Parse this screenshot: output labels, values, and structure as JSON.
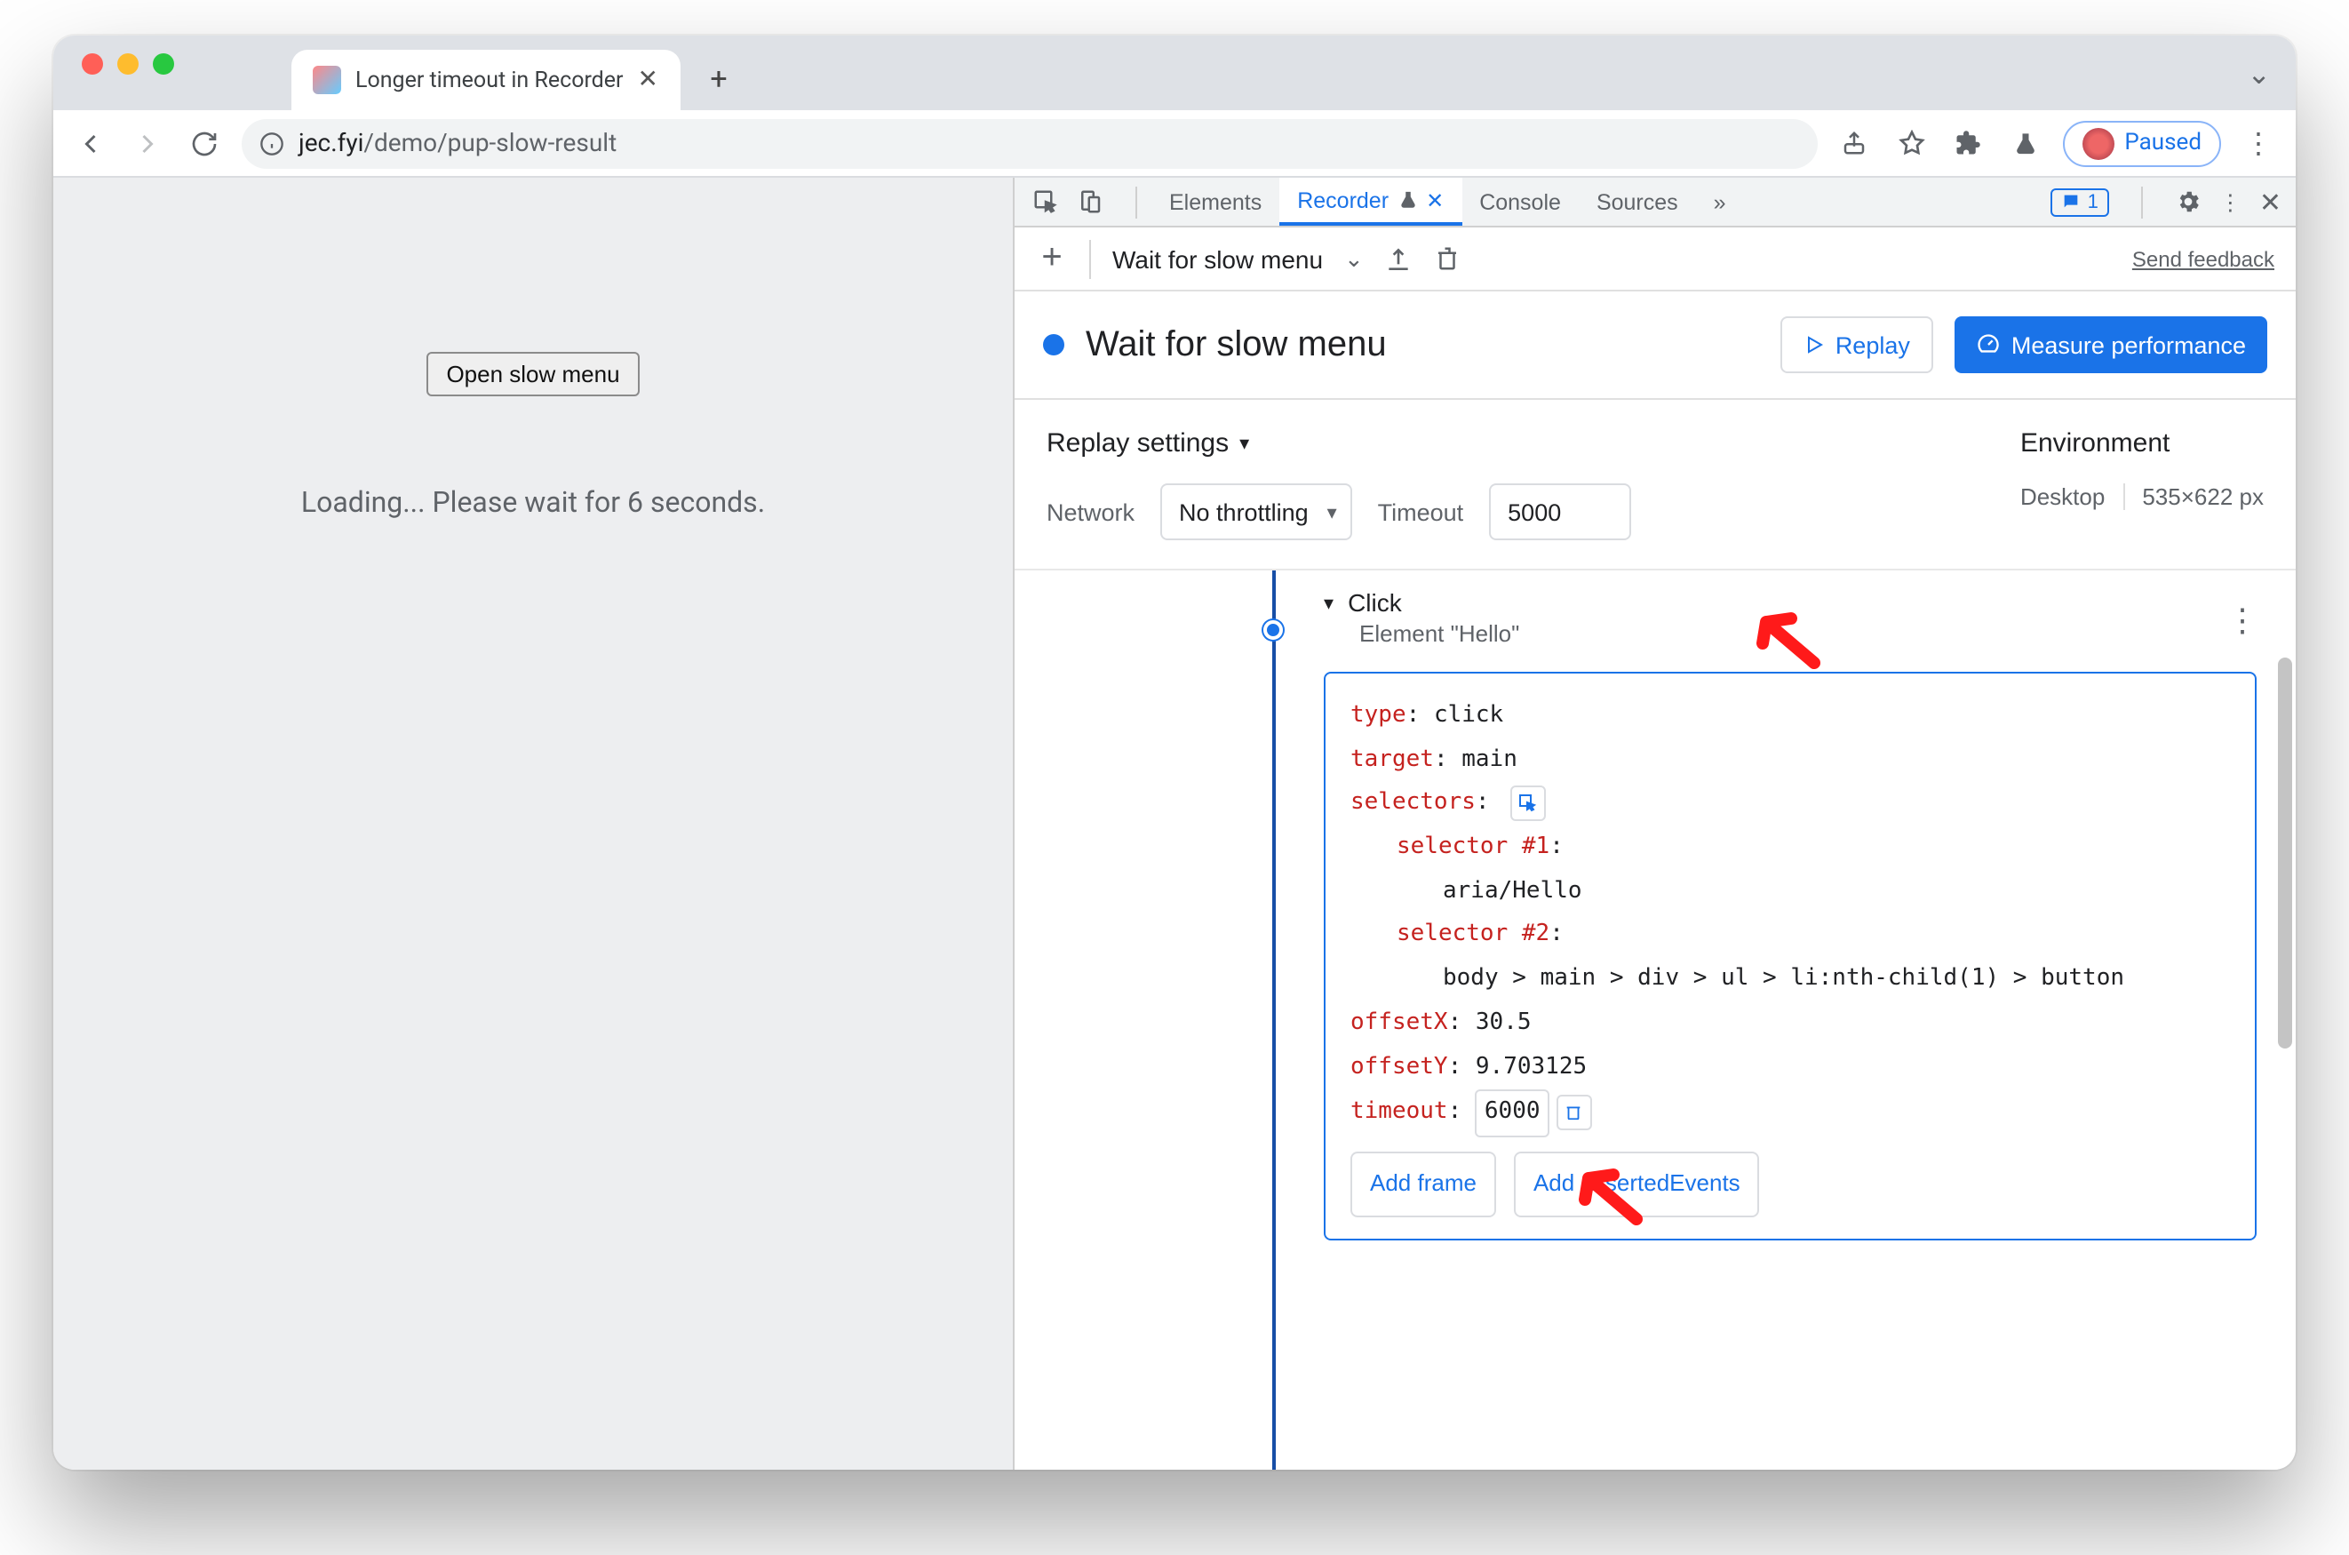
{
  "browser": {
    "tab_title": "Longer timeout in Recorder",
    "url_host": "jec.fyi",
    "url_path": "/demo/pup-slow-result",
    "profile_status": "Paused"
  },
  "page": {
    "button_label": "Open slow menu",
    "loading_text": "Loading... Please wait for 6 seconds."
  },
  "devtools": {
    "tabs": {
      "elements": "Elements",
      "recorder": "Recorder",
      "console": "Console",
      "sources": "Sources"
    },
    "msg_count": "1",
    "feedback": "Send feedback",
    "flow_name": "Wait for slow menu",
    "header_title": "Wait for slow menu",
    "replay_btn": "Replay",
    "measure_btn": "Measure performance",
    "replay_settings_title": "Replay settings",
    "network_label": "Network",
    "network_value": "No throttling",
    "timeout_label": "Timeout",
    "timeout_value": "5000",
    "env_title": "Environment",
    "env_device": "Desktop",
    "env_size": "535×622 px",
    "step": {
      "title": "Click",
      "subtitle": "Element \"Hello\"",
      "props": {
        "type_k": "type",
        "type_v": "click",
        "target_k": "target",
        "target_v": "main",
        "selectors_k": "selectors",
        "sel1_k": "selector #1",
        "sel1_v": "aria/Hello",
        "sel2_k": "selector #2",
        "sel2_v": "body > main > div > ul > li:nth-child(1) > button",
        "offx_k": "offsetX",
        "offx_v": "30.5",
        "offy_k": "offsetY",
        "offy_v": "9.703125",
        "timeout_k": "timeout",
        "timeout_v": "6000"
      },
      "add_frame": "Add frame",
      "add_asserted": "Add assertedEvents"
    }
  }
}
